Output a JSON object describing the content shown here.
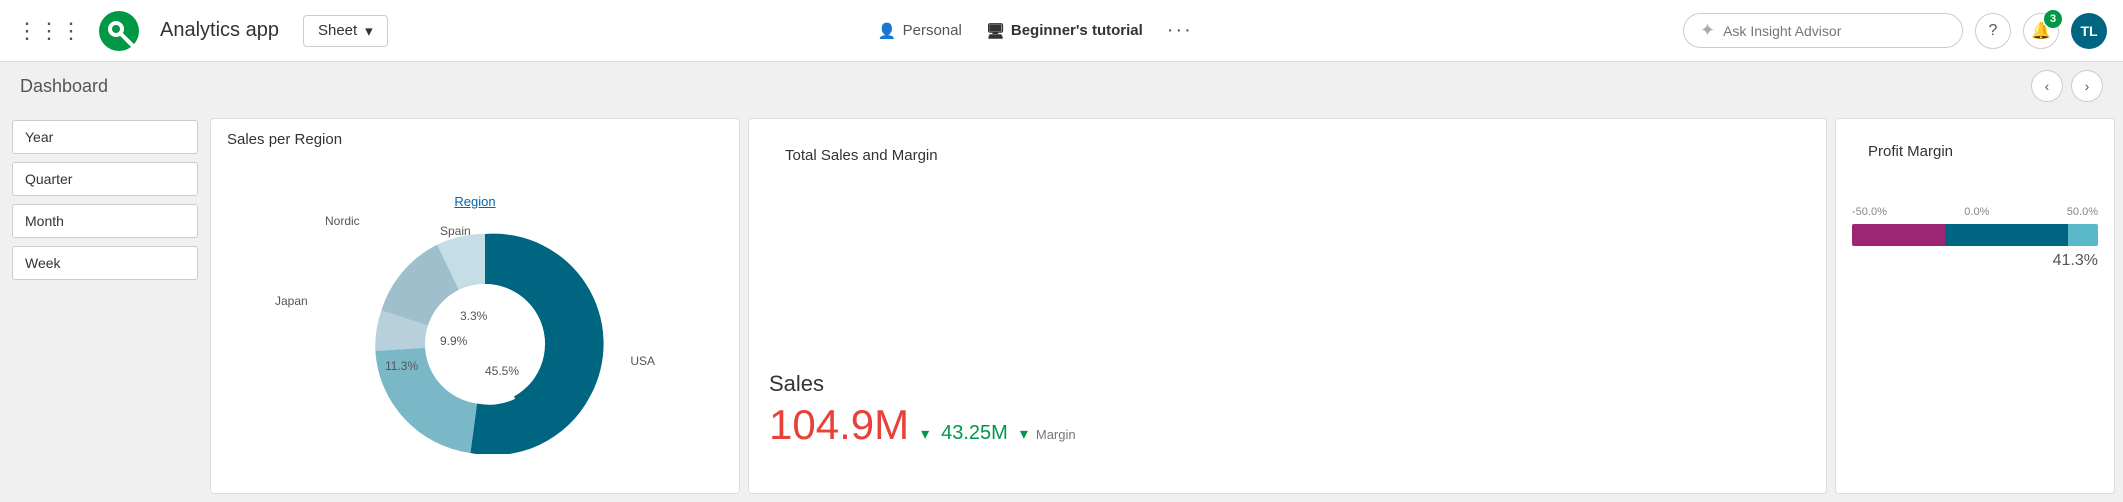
{
  "topnav": {
    "app_name": "Analytics app",
    "sheet_label": "Sheet",
    "personal_label": "Personal",
    "tutorial_label": "Beginner's tutorial",
    "more_label": "···",
    "insight_placeholder": "Ask Insight Advisor",
    "notification_count": "3",
    "avatar_initials": "TL"
  },
  "dashboard": {
    "title": "Dashboard",
    "nav_prev": "‹",
    "nav_next": "›"
  },
  "sidebar": {
    "filters": [
      {
        "label": "Year"
      },
      {
        "label": "Quarter"
      },
      {
        "label": "Month"
      },
      {
        "label": "Week"
      }
    ]
  },
  "sales_region": {
    "title": "Sales per Region",
    "legend_label": "Region",
    "segments": [
      {
        "label": "USA",
        "value": "45.5%",
        "color": "#006580"
      },
      {
        "label": "Nordic",
        "value": "",
        "color": "#7ab8c8"
      },
      {
        "label": "Spain",
        "value": "3.3%",
        "color": "#b0cfd9"
      },
      {
        "label": "Japan",
        "value": "11.3%",
        "color": "#a0bfcc"
      },
      {
        "label": "",
        "value": "9.9%",
        "color": "#c5dde6"
      }
    ]
  },
  "total_sales": {
    "title": "Total Sales and Margin",
    "sales_label": "Sales",
    "sales_value": "104.9M",
    "margin_value": "43.25M",
    "margin_label": "Margin"
  },
  "profit_margin": {
    "title": "Profit Margin",
    "axis_left": "-50.0%",
    "axis_center": "0.0%",
    "axis_right": "50.0%",
    "value": "41.3%",
    "bar": {
      "magenta_pct": 38,
      "teal_pct": 50,
      "light_pct": 12
    }
  },
  "icons": {
    "grid": "⊞",
    "chevron_down": "▾",
    "person": "👤",
    "monitor": "🖥",
    "question": "?",
    "bell": "🔔",
    "star_sparkle": "✦",
    "prev_arrow": "‹",
    "next_arrow": "›"
  }
}
